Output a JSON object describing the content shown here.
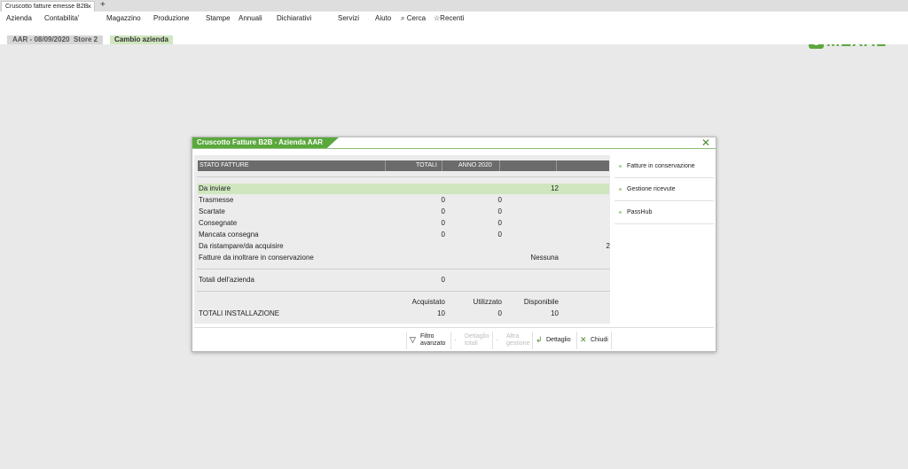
{
  "tab": {
    "title": "Cruscotto fatture emesse B2B",
    "close": "×",
    "new": "+"
  },
  "menu": {
    "items": [
      "Azienda",
      "Contabilita'",
      "Magazzino",
      "Produzione",
      "Stampe",
      "Annuali",
      "Dichiarativi",
      "Servizi",
      "Aiuto",
      "Cerca",
      "Recenti"
    ]
  },
  "logo": {
    "text": "MEXAL",
    "color": "#5aa83c"
  },
  "info": {
    "company_date": "AAR - 08/09/2020",
    "store": "Store 2",
    "change": "Cambio azienda"
  },
  "dialog": {
    "title": "Cruscotto Fatture B2B - Azienda AAR",
    "header": {
      "col1": "STATO FATTURE",
      "col2": "TOTALI",
      "col3": "ANNO 2020"
    },
    "rows": [
      {
        "label": "Da inviare",
        "totali": "",
        "anno": "",
        "extra": "12",
        "extra2": ""
      },
      {
        "label": "Trasmesse",
        "totali": "0",
        "anno": "0",
        "extra": "",
        "extra2": ""
      },
      {
        "label": "Scartate",
        "totali": "0",
        "anno": "0",
        "extra": "",
        "extra2": ""
      },
      {
        "label": "Consegnate",
        "totali": "0",
        "anno": "0",
        "extra": "",
        "extra2": ""
      },
      {
        "label": "Mancata consegna",
        "totali": "0",
        "anno": "0",
        "extra": "",
        "extra2": ""
      },
      {
        "label": "Da ristampare/da acquisire",
        "totali": "",
        "anno": "",
        "extra": "",
        "extra2": "2"
      },
      {
        "label": "Fatture da inoltrare in conservazione",
        "totali": "",
        "anno": "",
        "extra": "Nessuna",
        "extra2": ""
      }
    ],
    "totali_azienda": {
      "label": "Totali dell'azienda",
      "value": "0"
    },
    "installazione": {
      "headers": [
        "Acquistato",
        "Utilizzato",
        "Disponibile"
      ],
      "label": "TOTALI INSTALLAZIONE",
      "values": [
        "10",
        "0",
        "10"
      ]
    },
    "side": [
      "Fatture in conservazione",
      "Gestione ricevute",
      "PassHub"
    ],
    "buttons": {
      "filtro": [
        "Filtro",
        "avanzato"
      ],
      "dettaglio_totali": [
        "Dettaglio",
        "totali"
      ],
      "altra_gestione": [
        "Altra",
        "gestione"
      ],
      "dettaglio": "Dettaglio",
      "chiudi": "Chiudi"
    },
    "accent": "#5aa83c",
    "highlight": "#cfe6bf"
  }
}
